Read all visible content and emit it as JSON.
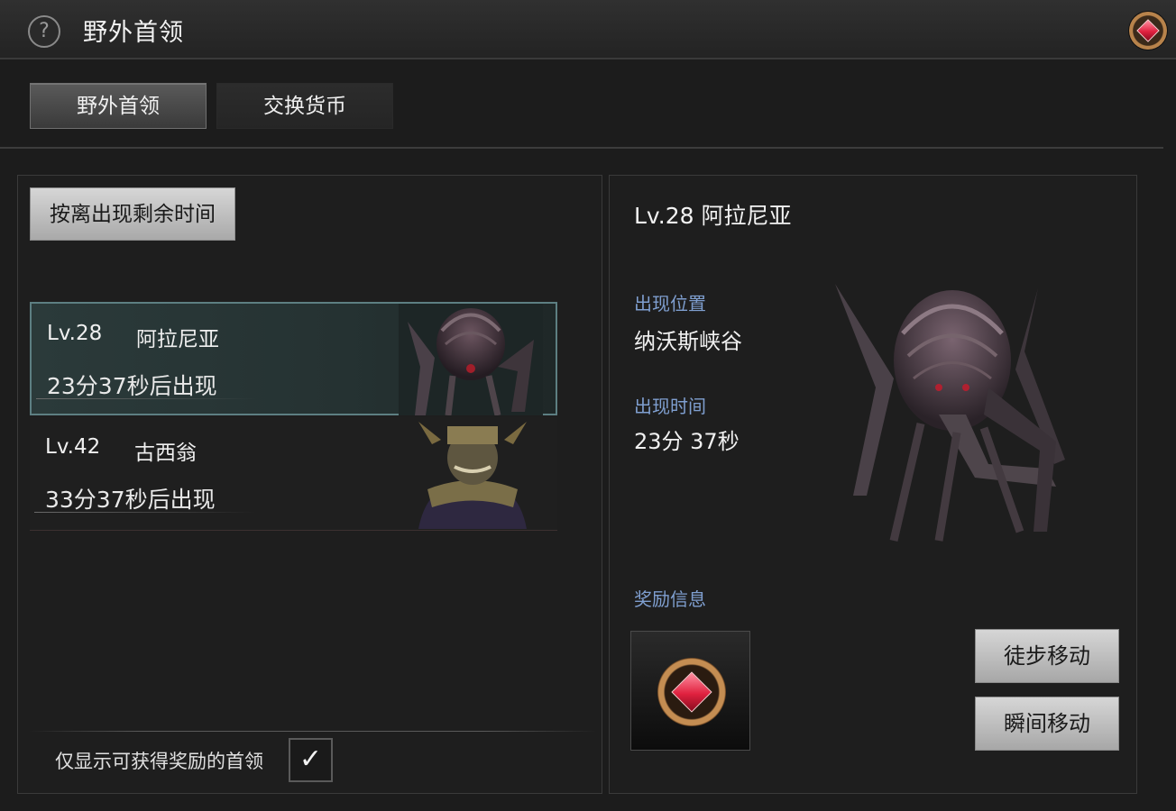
{
  "header": {
    "title": "野外首领",
    "help_icon": "?",
    "currency_icon": "red-gem-coin-icon"
  },
  "tabs": [
    {
      "label": "野外首领",
      "active": true
    },
    {
      "label": "交换货币",
      "active": false
    }
  ],
  "list_panel": {
    "sort_button_label": "按离出现剩余时间",
    "bosses": [
      {
        "level": "Lv.28",
        "name": "阿拉尼亚",
        "time": "23分37秒后出现",
        "selected": true,
        "portrait": "spider-beast-portrait"
      },
      {
        "level": "Lv.42",
        "name": "古西翁",
        "time": "33分37秒后出现",
        "selected": false,
        "portrait": "scarf-warrior-portrait"
      }
    ],
    "filter": {
      "label": "仅显示可获得奖励的首领",
      "checked": true,
      "check_mark": "✓"
    }
  },
  "detail_panel": {
    "title": "Lv.28 阿拉尼亚",
    "location_label": "出现位置",
    "location_value": "纳沃斯峡谷",
    "time_label": "出现时间",
    "time_value": "23分 37秒",
    "reward_label": "奖励信息",
    "reward_item_icon": "red-gem-coin-icon",
    "walk_button_label": "徒步移动",
    "teleport_button_label": "瞬间移动"
  },
  "colors": {
    "accent_label": "#7f9fd0",
    "selected_row": "#2b3a3a",
    "selected_border": "#5d7f82",
    "gem": "#e0213f"
  }
}
